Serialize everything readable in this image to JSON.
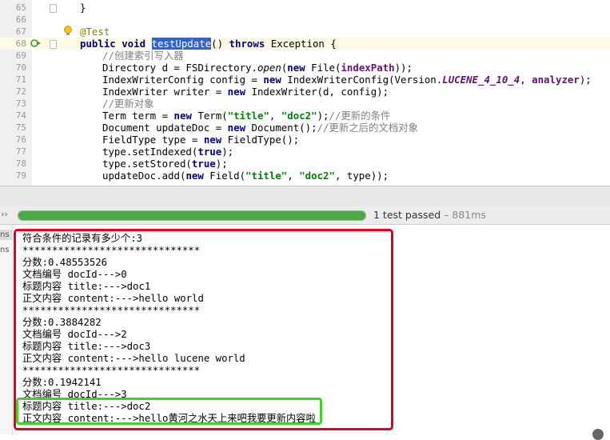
{
  "editor": {
    "lines": [
      {
        "num": "65",
        "parts": [
          {
            "t": "}",
            "c": ""
          }
        ]
      },
      {
        "num": "66",
        "parts": []
      },
      {
        "num": "67",
        "parts": [
          {
            "t": "@Test",
            "c": "ann"
          }
        ]
      },
      {
        "num": "68",
        "parts": [
          {
            "t": "public void ",
            "c": "kw"
          },
          {
            "t": "testUpdate",
            "c": "sel"
          },
          {
            "t": "() ",
            "c": ""
          },
          {
            "t": "throws ",
            "c": "kw"
          },
          {
            "t": "Exception {",
            "c": ""
          }
        ]
      },
      {
        "num": "69",
        "parts": [
          {
            "t": "//创建索引写入器",
            "c": "cmt"
          }
        ]
      },
      {
        "num": "70",
        "parts": [
          {
            "t": "Directory d = FSDirectory.",
            "c": ""
          },
          {
            "t": "open",
            "c": "it"
          },
          {
            "t": "(",
            "c": ""
          },
          {
            "t": "new ",
            "c": "kw"
          },
          {
            "t": "File(",
            "c": ""
          },
          {
            "t": "indexPath",
            "c": "fld2"
          },
          {
            "t": "));",
            "c": ""
          }
        ]
      },
      {
        "num": "71",
        "parts": [
          {
            "t": "IndexWriterConfig config = ",
            "c": ""
          },
          {
            "t": "new ",
            "c": "kw"
          },
          {
            "t": "IndexWriterConfig(Version.",
            "c": ""
          },
          {
            "t": "LUCENE_4_10_4",
            "c": "fld"
          },
          {
            "t": ", ",
            "c": ""
          },
          {
            "t": "analyzer",
            "c": "fld2"
          },
          {
            "t": ");",
            "c": ""
          }
        ]
      },
      {
        "num": "72",
        "parts": [
          {
            "t": "IndexWriter writer = ",
            "c": ""
          },
          {
            "t": "new ",
            "c": "kw"
          },
          {
            "t": "IndexWriter(d, config);",
            "c": ""
          }
        ]
      },
      {
        "num": "73",
        "parts": [
          {
            "t": "//更新对象",
            "c": "cmt"
          }
        ]
      },
      {
        "num": "74",
        "parts": [
          {
            "t": "Term term = ",
            "c": ""
          },
          {
            "t": "new ",
            "c": "kw"
          },
          {
            "t": "Term(",
            "c": ""
          },
          {
            "t": "\"title\"",
            "c": "str"
          },
          {
            "t": ", ",
            "c": ""
          },
          {
            "t": "\"doc2\"",
            "c": "str"
          },
          {
            "t": ");",
            "c": ""
          },
          {
            "t": "//更新的条件",
            "c": "cmt"
          }
        ]
      },
      {
        "num": "75",
        "parts": [
          {
            "t": "Document updateDoc = ",
            "c": ""
          },
          {
            "t": "new ",
            "c": "kw"
          },
          {
            "t": "Document();",
            "c": ""
          },
          {
            "t": "//更新之后的文档对象",
            "c": "cmt"
          }
        ]
      },
      {
        "num": "76",
        "parts": [
          {
            "t": "FieldType type = ",
            "c": ""
          },
          {
            "t": "new ",
            "c": "kw"
          },
          {
            "t": "FieldType();",
            "c": ""
          }
        ]
      },
      {
        "num": "77",
        "parts": [
          {
            "t": "type.setIndexed(",
            "c": ""
          },
          {
            "t": "true",
            "c": "kw"
          },
          {
            "t": ");",
            "c": ""
          }
        ]
      },
      {
        "num": "78",
        "parts": [
          {
            "t": "type.setStored(",
            "c": ""
          },
          {
            "t": "true",
            "c": "kw"
          },
          {
            "t": ");",
            "c": ""
          }
        ]
      },
      {
        "num": "79",
        "parts": [
          {
            "t": "updateDoc.add(",
            "c": ""
          },
          {
            "t": "new ",
            "c": "kw"
          },
          {
            "t": "Field(",
            "c": ""
          },
          {
            "t": "\"title\"",
            "c": "str"
          },
          {
            "t": ", ",
            "c": ""
          },
          {
            "t": "\"doc2\"",
            "c": "str"
          },
          {
            "t": ", type));",
            "c": ""
          }
        ]
      }
    ]
  },
  "test_bar": {
    "chevron": "››",
    "progress": 1.0,
    "status_label": "1 test passed",
    "duration": " – 881ms"
  },
  "left_strip": {
    "tab1": "ns",
    "tab2": "ns"
  },
  "console": {
    "lines": [
      "符合条件的记录有多少个:3",
      "******************************",
      "分数:0.48553526",
      "文档编号 docId--->0",
      "标题内容 title:--->doc1",
      "正文内容 content:--->hello world",
      "******************************",
      "分数:0.3884282",
      "文档编号 docId--->2",
      "标题内容 title:--->doc3",
      "正文内容 content:--->hello lucene world",
      "******************************",
      "分数:0.1942141",
      "文档编号 docId--->3",
      "标题内容 title:--->doc2",
      "正文内容 content:--->hello黄河之水天上来吧我要更新内容啦"
    ]
  },
  "colors": {
    "highlight_red": "#e3001c",
    "highlight_green": "#44d12b",
    "progress_green": "#4ea84a"
  }
}
